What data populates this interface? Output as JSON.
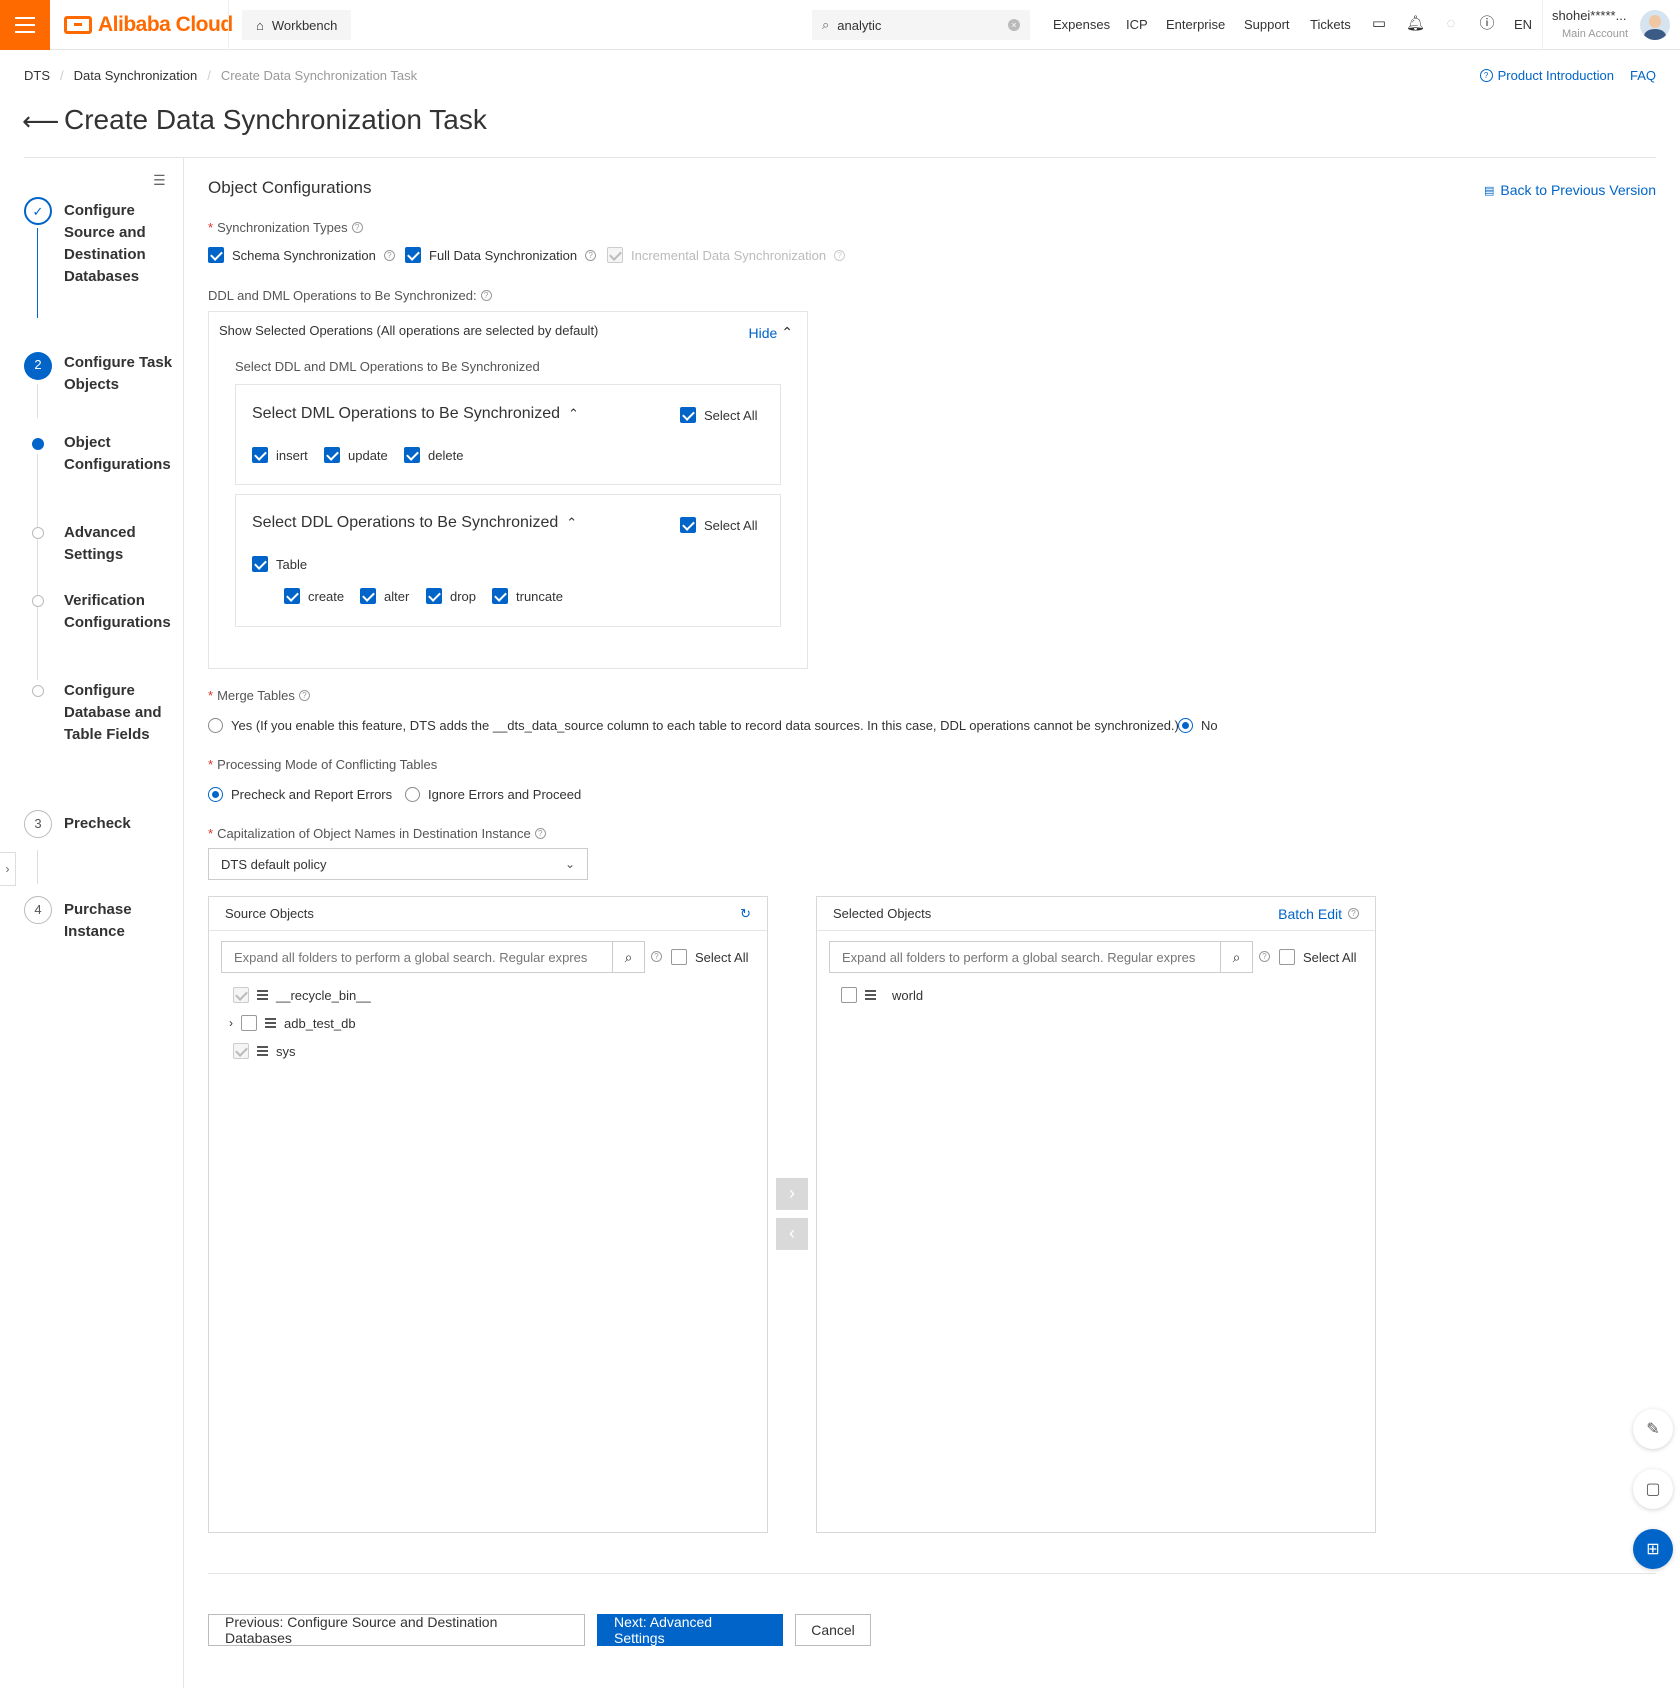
{
  "topbar": {
    "brand": "Alibaba Cloud",
    "workbench": "Workbench",
    "search_value": "analytic",
    "nav": [
      "Expenses",
      "ICP",
      "Enterprise",
      "Support",
      "Tickets"
    ],
    "lang": "EN",
    "user_name": "shohei*****...",
    "user_role": "Main Account",
    "icons": [
      "menu-icon",
      "home-icon",
      "search-icon",
      "clear-icon",
      "terminal-icon",
      "bell-icon",
      "bulb-icon",
      "help-icon"
    ]
  },
  "breadcrumb": [
    "DTS",
    "Data Synchronization",
    "Create Data Synchronization Task"
  ],
  "top_links": {
    "product_intro": "Product Introduction",
    "faq": "FAQ"
  },
  "page_title": "Create Data Synchronization Task",
  "steps": [
    {
      "num": "",
      "label": "Configure Source and Destination Databases",
      "state": "done"
    },
    {
      "num": "2",
      "label": "Configure Task Objects",
      "state": "active"
    },
    {
      "num": "",
      "label": "Object Configurations",
      "state": "sub-active"
    },
    {
      "num": "",
      "label": "Advanced Settings",
      "state": "sub"
    },
    {
      "num": "",
      "label": "Verification Configurations",
      "state": "sub"
    },
    {
      "num": "",
      "label": "Configure Database and Table Fields",
      "state": "sub"
    },
    {
      "num": "3",
      "label": "Precheck",
      "state": "todo"
    },
    {
      "num": "4",
      "label": "Purchase Instance",
      "state": "todo"
    }
  ],
  "section_title": "Object Configurations",
  "back_prev_version": "Back to Previous Version",
  "sync_types": {
    "label": "Synchronization Types",
    "options": [
      {
        "label": "Schema Synchronization",
        "checked": true,
        "disabled": false
      },
      {
        "label": "Full Data Synchronization",
        "checked": true,
        "disabled": false
      },
      {
        "label": "Incremental Data Synchronization",
        "checked": true,
        "disabled": true
      }
    ]
  },
  "ddl_dml": {
    "label": "DDL and DML Operations to Be Synchronized:",
    "show_selected": "Show Selected Operations (All operations are selected by default)",
    "hide": "Hide",
    "select_heading": "Select DDL and DML Operations to Be Synchronized",
    "dml_title": "Select DML Operations to Be Synchronized",
    "dml_select_all": "Select All",
    "dml_ops": [
      "insert",
      "update",
      "delete"
    ],
    "ddl_title": "Select DDL Operations to Be Synchronized",
    "ddl_select_all": "Select All",
    "ddl_table": "Table",
    "ddl_ops": [
      "create",
      "alter",
      "drop",
      "truncate"
    ]
  },
  "merge_tables": {
    "label": "Merge Tables",
    "yes": "Yes (If you enable this feature, DTS adds the __dts_data_source column to each table to record data sources. In this case, DDL operations cannot be synchronized.)",
    "no": "No",
    "selected": "No"
  },
  "conflict_mode": {
    "label": "Processing Mode of Conflicting Tables",
    "options": [
      "Precheck and Report Errors",
      "Ignore Errors and Proceed"
    ],
    "selected": "Precheck and Report Errors"
  },
  "capitalization": {
    "label": "Capitalization of Object Names in Destination Instance",
    "value": "DTS default policy"
  },
  "source_objects": {
    "title": "Source Objects",
    "placeholder": "Expand all folders to perform a global search. Regular expres",
    "select_all": "Select All",
    "items": [
      "__recycle_bin__",
      "adb_test_db",
      "sys"
    ]
  },
  "selected_objects": {
    "title": "Selected Objects",
    "batch_edit": "Batch Edit",
    "placeholder": "Expand all folders to perform a global search. Regular expres",
    "select_all": "Select All",
    "items": [
      "world"
    ]
  },
  "buttons": {
    "previous": "Previous: Configure Source and Destination Databases",
    "next": "Next: Advanced Settings",
    "cancel": "Cancel"
  },
  "colors": {
    "brand": "#ff6a00",
    "primary": "#0064c8"
  }
}
